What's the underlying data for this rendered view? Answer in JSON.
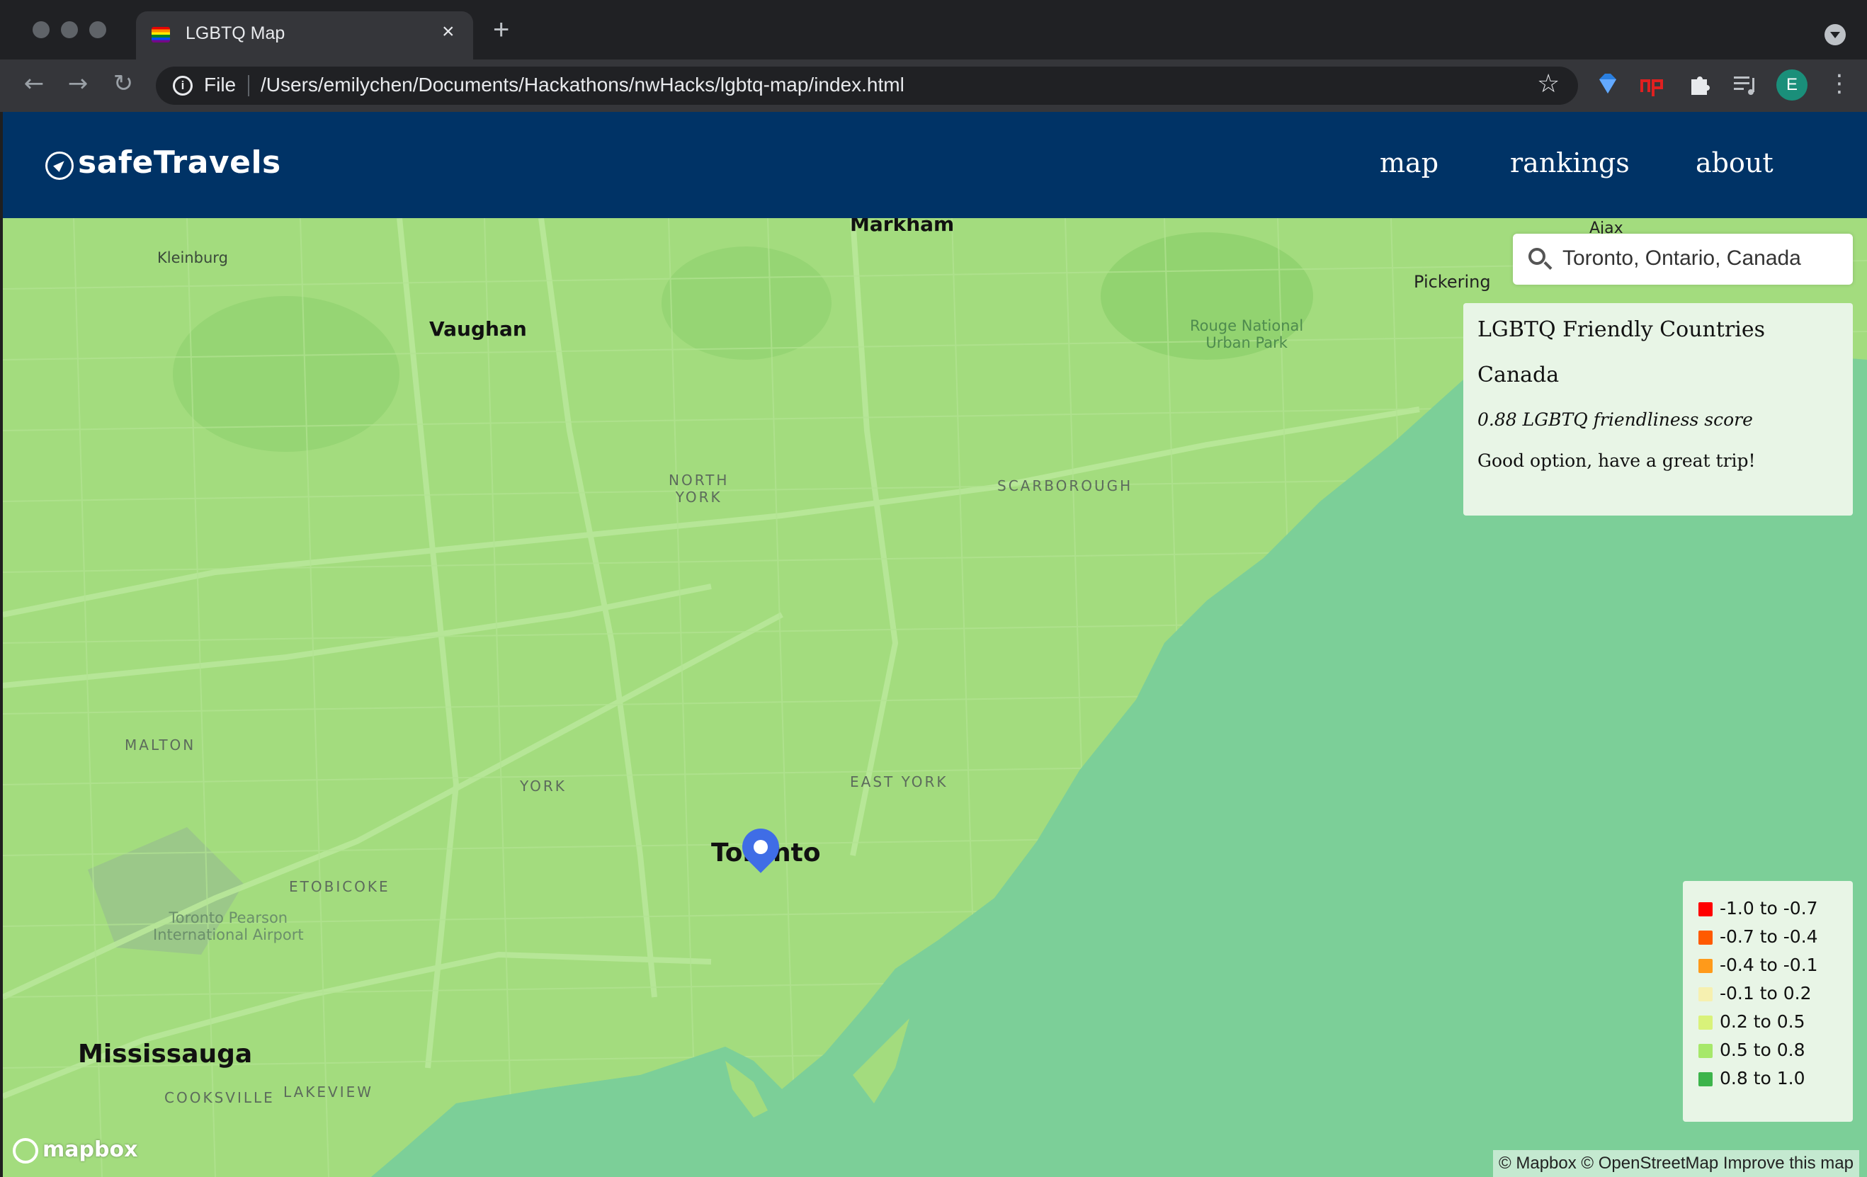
{
  "browser": {
    "tab_title": "LGBTQ Map",
    "tab_close": "×",
    "new_tab": "+",
    "scheme_label": "File",
    "url": "/Users/emilychen/Documents/Hackathons/nwHacks/lgbtq-map/index.html",
    "profile_initial": "E"
  },
  "site": {
    "brand": "safeTravels",
    "nav": [
      "map",
      "rankings",
      "about"
    ]
  },
  "map": {
    "search_value": "Toronto, Ontario, Canada",
    "places": {
      "markham": "Markham",
      "kleinburg": "Kleinburg",
      "vaughan": "Vaughan",
      "pickering": "Pickering",
      "ajax": "Ajax",
      "rouge_park": "Rouge National\nUrban Park",
      "north_york": "NORTH\nYORK",
      "scarborough": "SCARBOROUGH",
      "malton": "MALTON",
      "york": "YORK",
      "east_york": "EAST YORK",
      "pearson": "Toronto Pearson\nInternational Airport",
      "etobicoke": "ETOBICOKE",
      "toronto": "Toronto",
      "mississauga": "Mississauga",
      "cooksville": "COOKSVILLE",
      "lakeview": "LAKEVIEW"
    },
    "land_color": "#a3dc7e",
    "water_color": "#7ccf98",
    "attribution": "© Mapbox © OpenStreetMap Improve this map",
    "mapbox_logo": "mapbox"
  },
  "info_panel": {
    "title": "LGBTQ Friendly Countries",
    "country": "Canada",
    "score": "0.88 LGBTQ friendliness score",
    "message": "Good option, have a great trip!"
  },
  "legend": [
    {
      "label": "-1.0 to -0.7",
      "color": "#ff0000"
    },
    {
      "label": "-0.7 to -0.4",
      "color": "#ff5a00"
    },
    {
      "label": "-0.4 to -0.1",
      "color": "#ff9a1a"
    },
    {
      "label": "-0.1 to 0.2",
      "color": "#f6f0b0"
    },
    {
      "label": "0.2 to 0.5",
      "color": "#d9f27a"
    },
    {
      "label": "0.5 to 0.8",
      "color": "#a6e86a"
    },
    {
      "label": "0.8 to 1.0",
      "color": "#3cb44b"
    }
  ]
}
